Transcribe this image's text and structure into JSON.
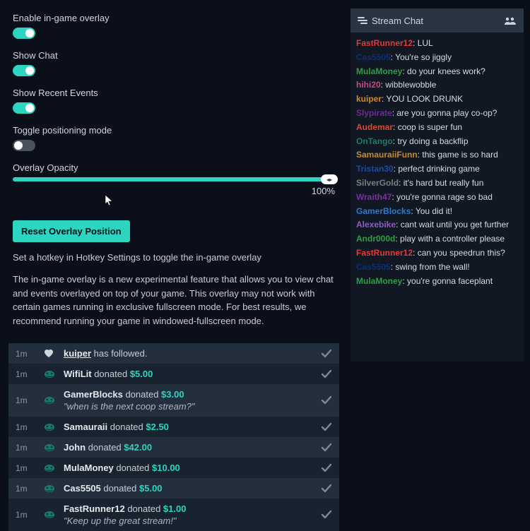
{
  "settings": {
    "overlay_label": "Enable in-game overlay",
    "overlay_on": true,
    "chat_label": "Show Chat",
    "chat_on": true,
    "events_label": "Show Recent Events",
    "events_on": true,
    "position_label": "Toggle positioning mode",
    "position_on": false,
    "opacity_label": "Overlay Opacity",
    "opacity_value": "100%",
    "reset_button": "Reset Overlay Position",
    "hotkey_hint": "Set a hotkey in Hotkey Settings to toggle the in-game overlay",
    "description": "The in-game overlay is a new experimental feature that allows you to view chat and events overlayed on top of your game. This overlay may not work with certain games running in exclusive fullscreen mode. For best results, we recommend running your game in windowed-fullscreen mode."
  },
  "events": [
    {
      "time": "1m",
      "icon": "follow",
      "user": "kuiper",
      "action": "has followed.",
      "underline": true
    },
    {
      "time": "1m",
      "icon": "donate",
      "user": "WifiLit",
      "action": "donated",
      "amount": "$5.00"
    },
    {
      "time": "1m",
      "icon": "donate",
      "user": "GamerBlocks",
      "action": "donated",
      "amount": "$3.00",
      "message": "\"when is the next coop stream?\""
    },
    {
      "time": "1m",
      "icon": "donate",
      "user": "Samauraii",
      "action": "donated",
      "amount": "$2.50"
    },
    {
      "time": "1m",
      "icon": "donate",
      "user": "John",
      "action": "donated",
      "amount": "$42.00"
    },
    {
      "time": "1m",
      "icon": "donate",
      "user": "MulaMoney",
      "action": "donated",
      "amount": "$10.00"
    },
    {
      "time": "1m",
      "icon": "donate",
      "user": "Cas5505",
      "action": "donated",
      "amount": "$5.00"
    },
    {
      "time": "1m",
      "icon": "donate",
      "user": "FastRunner12",
      "action": "donated",
      "amount": "$1.00",
      "message": "\"Keep up the great stream!\""
    }
  ],
  "chat": {
    "title": "Stream Chat",
    "lines": [
      {
        "user": "FastRunner12",
        "color": "#e03a3a",
        "text": "LUL"
      },
      {
        "user": "Cas5505",
        "color": "#0c2f73",
        "text": "You're so jiggly"
      },
      {
        "user": "MulaMoney",
        "color": "#2f9e44",
        "text": "do your knees work?"
      },
      {
        "user": "hihi20",
        "color": "#c24a85",
        "text": "wibblewobble"
      },
      {
        "user": "kuiper",
        "color": "#d18a2a",
        "text": "YOU LOOK DRUNK"
      },
      {
        "user": "Slypirate",
        "color": "#6f2b8f",
        "text": "are you gonna play co-op?"
      },
      {
        "user": "Audemar",
        "color": "#d94a2e",
        "text": "coop is super fun"
      },
      {
        "user": "OnTango",
        "color": "#1f7a5f",
        "text": "try doing a backflip"
      },
      {
        "user": "SamauraiiFunn",
        "color": "#c48a2f",
        "text": "this game is so hard"
      },
      {
        "user": "Tristan30",
        "color": "#1a4aa8",
        "text": "perfect drinking game"
      },
      {
        "user": "SilverGold",
        "color": "#7d7d7d",
        "text": "it's hard but really fun"
      },
      {
        "user": "Wraith47",
        "color": "#7a2f9e",
        "text": "you're gonna rage so bad"
      },
      {
        "user": "GamerBlocks",
        "color": "#2a7ad1",
        "text": "You did it!"
      },
      {
        "user": "Alexebike",
        "color": "#8a5fbf",
        "text": "cant wait until you get further"
      },
      {
        "user": "Andr000d",
        "color": "#2f9e44",
        "text": "play with a controller please"
      },
      {
        "user": "FastRunner12",
        "color": "#e03a3a",
        "text": "can you speedrun this?"
      },
      {
        "user": "Cas5505",
        "color": "#0c2f73",
        "text": "swing from the wall!"
      },
      {
        "user": "MulaMoney",
        "color": "#2f9e44",
        "text": "you're gonna faceplant"
      }
    ]
  }
}
